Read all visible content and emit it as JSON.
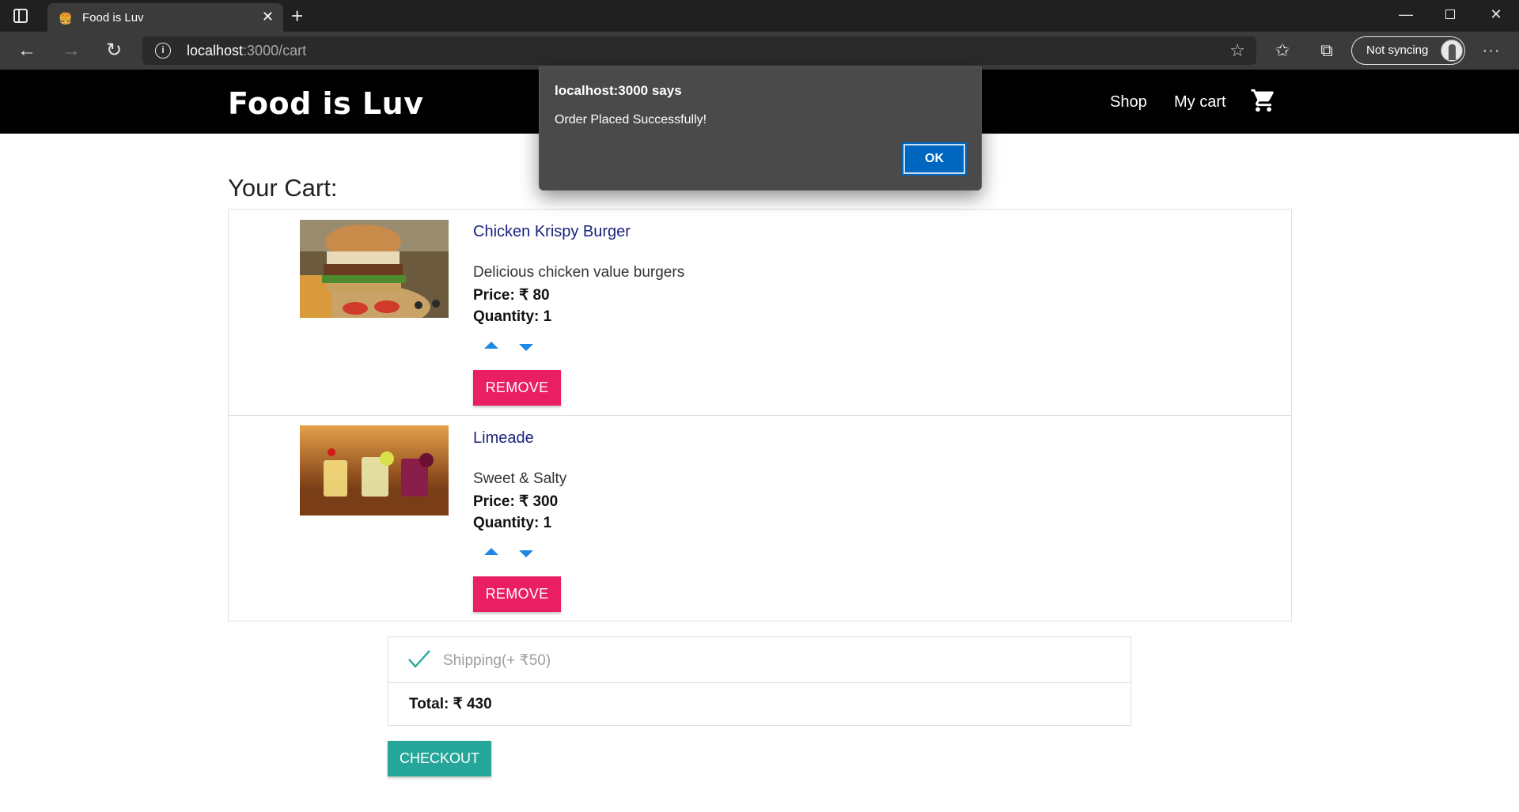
{
  "browser": {
    "tab_title": "Food is Luv",
    "tab_favicon": "🍔",
    "url_host": "localhost",
    "url_path": ":3000/cart",
    "sync_label": "Not syncing"
  },
  "site": {
    "brand": "Food is Luv",
    "nav": {
      "shop": "Shop",
      "my_cart": "My cart"
    }
  },
  "cart": {
    "heading": "Your Cart:",
    "items": [
      {
        "name": "Chicken Krispy Burger",
        "description": "Delicious chicken value burgers",
        "price": "Price: ₹ 80",
        "quantity": "Quantity: 1",
        "remove_label": "REMOVE"
      },
      {
        "name": "Limeade",
        "description": "Sweet & Salty",
        "price": "Price: ₹ 300",
        "quantity": "Quantity: 1",
        "remove_label": "REMOVE"
      }
    ],
    "shipping_label": "Shipping(+ ₹50)",
    "shipping_checked": true,
    "total": "Total: ₹ 430",
    "checkout_label": "CHECKOUT"
  },
  "dialog": {
    "title": "localhost:3000 says",
    "message": "Order Placed Successfully!",
    "ok_label": "OK"
  },
  "colors": {
    "navbar": "#000000",
    "item_title": "#1a237e",
    "remove_button": "#e91e63",
    "checkout_button": "#26a69a",
    "qty_arrows": "#1e88e5",
    "dialog_ok": "#0067c0"
  }
}
